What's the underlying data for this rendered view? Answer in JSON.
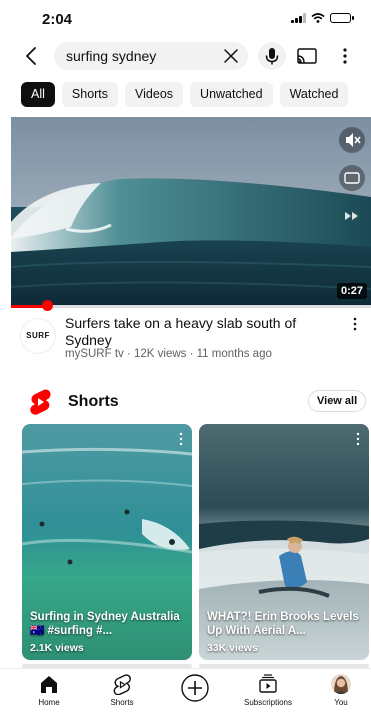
{
  "status": {
    "time": "2:04"
  },
  "search": {
    "query": "surfing sydney"
  },
  "filters": [
    {
      "label": "All",
      "active": true
    },
    {
      "label": "Shorts",
      "active": false
    },
    {
      "label": "Videos",
      "active": false
    },
    {
      "label": "Unwatched",
      "active": false
    },
    {
      "label": "Watched",
      "active": false
    }
  ],
  "video": {
    "duration": "0:27",
    "progress": 0.1,
    "title": "Surfers take on a heavy slab south of Sydney",
    "channel_avatar_text": "SURF",
    "meta": "mySURF tv · 12K views · 11 months ago"
  },
  "shorts": {
    "heading": "Shorts",
    "view_all": "View all",
    "items": [
      {
        "title": "Surfing in Sydney Australia 🇦🇺 #surfing #...",
        "views": "2.1K views"
      },
      {
        "title": "WHAT?! Erin Brooks Levels Up With Aerial A...",
        "views": "33K views"
      }
    ]
  },
  "nav": {
    "home": "Home",
    "shorts": "Shorts",
    "subscriptions": "Subscriptions",
    "you": "You"
  },
  "colors": {
    "accent": "#ff0000",
    "text": "#0f0f0f",
    "secondary_text": "#606060",
    "chip_bg": "#f2f2f2"
  }
}
